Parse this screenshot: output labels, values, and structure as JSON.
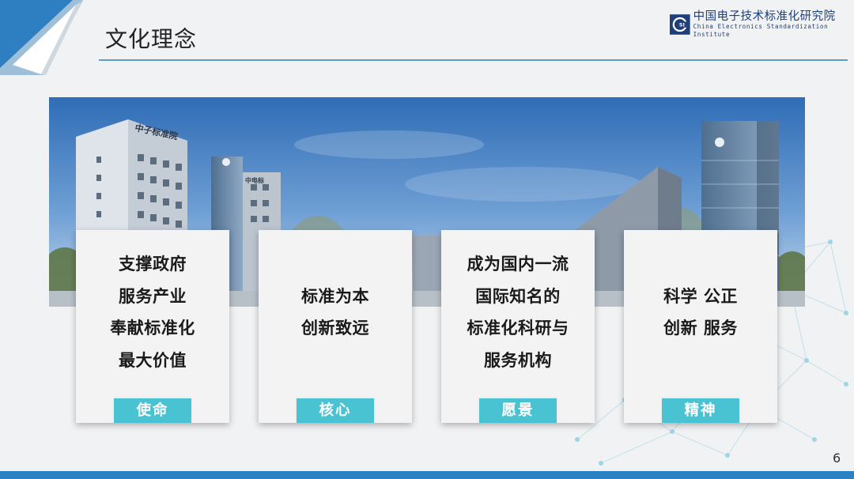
{
  "slide": {
    "title": "文化理念",
    "page_number": "6",
    "accent_color": "#2a82c4",
    "tag_color": "#49c3d2"
  },
  "logo": {
    "name_cn": "中国电子技术标准化研究院",
    "name_en": "China Electronics Standardization Institute",
    "mark_text": "CESI"
  },
  "banner": {
    "building_signs": [
      "中子标准院",
      "中电标"
    ]
  },
  "cards": [
    {
      "lines": [
        "支撑政府",
        "服务产业",
        "奉献标准化",
        "最大价值"
      ],
      "tag": "使命"
    },
    {
      "lines": [
        "标准为本",
        "创新致远"
      ],
      "tag": "核心"
    },
    {
      "lines": [
        "成为国内一流",
        "国际知名的",
        "标准化科研与",
        "服务机构"
      ],
      "tag": "愿景"
    },
    {
      "lines": [
        "科学 公正",
        "创新 服务"
      ],
      "tag": "精神"
    }
  ]
}
